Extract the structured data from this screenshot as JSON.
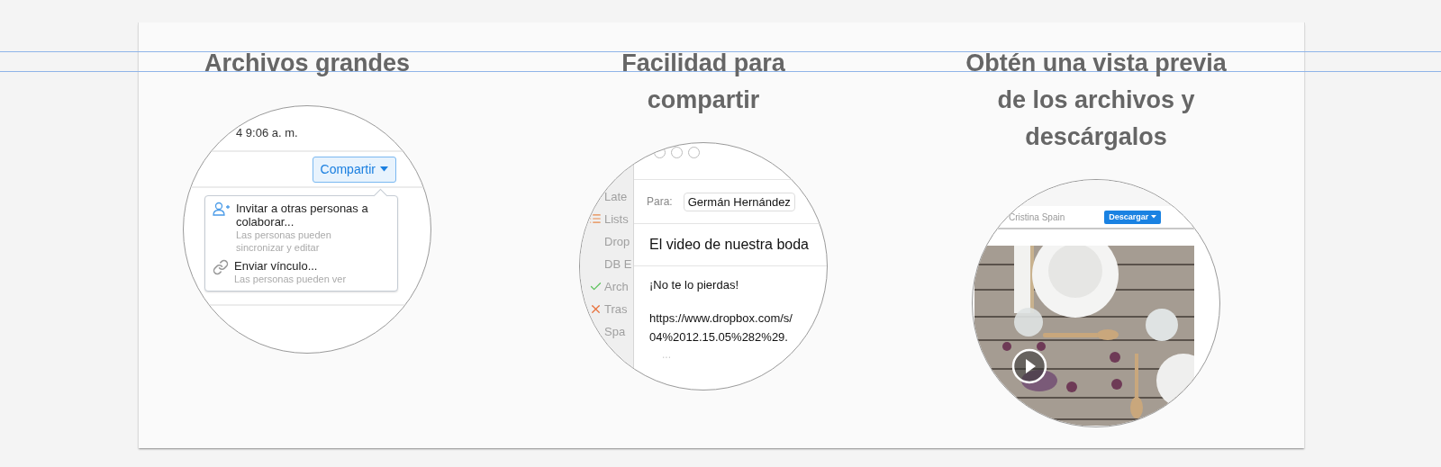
{
  "features": [
    {
      "kind": "share_menu",
      "title": "Archivos grandes",
      "timestamp": "4 9:06 a. m.",
      "button": "Compartir",
      "menu": [
        {
          "kind": "invite",
          "label": "Invitar a otras personas a colaborar...",
          "hint": "Las personas pueden sincronizar y editar"
        },
        {
          "kind": "link",
          "label": "Enviar vínculo...",
          "hint": "Las personas pueden ver"
        }
      ]
    },
    {
      "kind": "email",
      "title": "Facilidad para compartir",
      "sidebar": [
        {
          "kind": "plain",
          "label": "Late"
        },
        {
          "kind": "list",
          "label": "Lists"
        },
        {
          "kind": "plain",
          "label": "Drop"
        },
        {
          "kind": "plain",
          "label": "DB E"
        },
        {
          "kind": "check",
          "label": "Arch"
        },
        {
          "kind": "cross",
          "label": "Tras"
        },
        {
          "kind": "plain",
          "label": "Spa"
        }
      ],
      "to_label": "Para:",
      "to_value": "Germán Hernández",
      "subject": "El video de nuestra boda",
      "body": [
        "¡No te lo pierdas!",
        "https://www.dropbox.com/s/",
        "04%2012.15.05%282%29."
      ],
      "more": "..."
    },
    {
      "kind": "preview",
      "title": "Obtén una vista previa de los archivos y descárgalos",
      "owner": "Cristina Spain",
      "button": "Descargar"
    }
  ]
}
